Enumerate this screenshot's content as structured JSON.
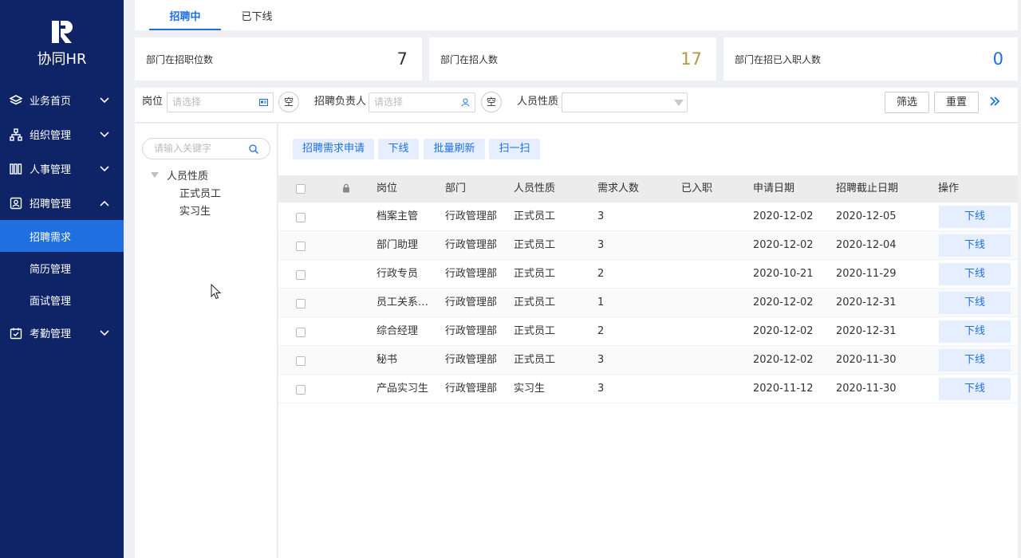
{
  "app": {
    "logo_text": "协同HR"
  },
  "colors": {
    "sidebar_bg": "#0e2466",
    "accent": "#1f6fe0",
    "count_orange": "#b8963b",
    "count_blue": "#1f6fe0"
  },
  "sidebar": {
    "items": [
      {
        "label": "业务首页",
        "icon": "layers-icon"
      },
      {
        "label": "组织管理",
        "icon": "org-chart-icon"
      },
      {
        "label": "人事管理",
        "icon": "books-icon"
      },
      {
        "label": "招聘管理",
        "icon": "id-card-icon"
      },
      {
        "label": "考勤管理",
        "icon": "calendar-check-icon"
      }
    ],
    "sub_items": [
      {
        "label": "招聘需求",
        "active": true
      },
      {
        "label": "简历管理"
      },
      {
        "label": "面试管理"
      }
    ]
  },
  "tabs": [
    {
      "label": "招聘中",
      "active": true
    },
    {
      "label": "已下线"
    }
  ],
  "stats": [
    {
      "label": "部门在招职位数",
      "value": "7"
    },
    {
      "label": "部门在招人数",
      "value": "17"
    },
    {
      "label": "部门在招已入职人数",
      "value": "0"
    }
  ],
  "filters": {
    "position_label": "岗位",
    "position_placeholder": "请选择",
    "clear_label": "空",
    "owner_label": "招聘负责人",
    "owner_placeholder": "请选择",
    "type_label": "人员性质",
    "type_value": "",
    "filter_button": "筛选",
    "reset_button": "重置"
  },
  "tree": {
    "search_placeholder": "请输入关键字",
    "root": "人员性质",
    "children": [
      "正式员工",
      "实习生"
    ]
  },
  "actions": {
    "apply": "招聘需求申请",
    "offline": "下线",
    "batch_refresh": "批量刷新",
    "scan": "扫一扫"
  },
  "table": {
    "headers": {
      "position": "岗位",
      "department": "部门",
      "type": "人员性质",
      "headcount": "需求人数",
      "hired": "已入职",
      "apply_date": "申请日期",
      "deadline": "招聘截止日期",
      "operation": "操作"
    },
    "row_action": "下线",
    "rows": [
      {
        "position": "档案主管",
        "department": "行政管理部",
        "type": "正式员工",
        "headcount": "3",
        "hired": "",
        "apply_date": "2020-12-02",
        "deadline": "2020-12-05"
      },
      {
        "position": "部门助理",
        "department": "行政管理部",
        "type": "正式员工",
        "headcount": "3",
        "hired": "",
        "apply_date": "2020-12-02",
        "deadline": "2020-12-04"
      },
      {
        "position": "行政专员",
        "department": "行政管理部",
        "type": "正式员工",
        "headcount": "2",
        "hired": "",
        "apply_date": "2020-10-21",
        "deadline": "2020-11-29"
      },
      {
        "position": "员工关系…",
        "department": "行政管理部",
        "type": "正式员工",
        "headcount": "1",
        "hired": "",
        "apply_date": "2020-12-02",
        "deadline": "2020-12-31"
      },
      {
        "position": "综合经理",
        "department": "行政管理部",
        "type": "正式员工",
        "headcount": "2",
        "hired": "",
        "apply_date": "2020-12-02",
        "deadline": "2020-12-31"
      },
      {
        "position": "秘书",
        "department": "行政管理部",
        "type": "正式员工",
        "headcount": "3",
        "hired": "",
        "apply_date": "2020-12-02",
        "deadline": "2020-11-30"
      },
      {
        "position": "产品实习生",
        "department": "行政管理部",
        "type": "实习生",
        "headcount": "3",
        "hired": "",
        "apply_date": "2020-11-12",
        "deadline": "2020-11-30"
      }
    ]
  }
}
